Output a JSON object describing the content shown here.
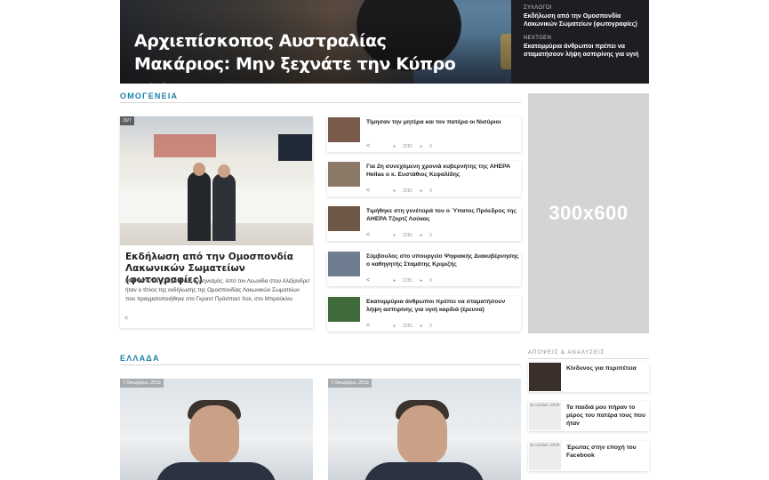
{
  "hero": {
    "title": "Αρχιεπίσκοπος Αυστραλίας Μακάριος: Μην ξεχνάτε την Κύπρο μας",
    "side": [
      {
        "category": "ΣΥΛΛΟΓΟΙ",
        "title": "Εκδήλωση από την Ομοσπονδία Λακωνικών Σωματείων (φωτογραφίες)"
      },
      {
        "category": "NEXTGEN",
        "title": "Εκατομμύρια άνθρωποι πρέπει να σταματήσουν λήψη ασπιρίνης για υγιή"
      }
    ]
  },
  "sections": {
    "omogeneia": "ΟΜΟΓΕΝΕΙΑ",
    "ellada": "ΕΛΛΑΔΑ",
    "opinions": "ΑΠΟΨΕΙΣ & ΑΝΑΛΥΣΕΙΣ"
  },
  "featured": {
    "date": "29/7",
    "title": "Εκδήλωση από την Ομοσπονδία Λακωνικών Σωματείων (φωτογραφίες)",
    "excerpt": "ΜΠΡΟΥΚΛΙΝ. Ολυμπιακός Ελληνισμός. Από τον Λεωνίδα στον Αλέξανδρο' ήταν ο τίτλος της εκδήλωσης της Ομοσπονδίας Λακωνικών Σωματείων που πραγματοποιήθηκε στο Γκραντ Πρόσπεκτ Χολ, στο Μπρούκλιν."
  },
  "list_items": [
    {
      "title": "Τίμησαν την μητέρα και τον πατέρα οι Νισύριοι",
      "views": "2281",
      "comments": "0",
      "thumb_color": "#7a5a4a"
    },
    {
      "title": "Για 2η συνεχόμενη χρονιά κυβερνήτης της AHEPA Hellas ο κ. Ευστάθιος Κεφαλίδης",
      "views": "2281",
      "comments": "0",
      "thumb_color": "#8b7a68"
    },
    {
      "title": "Τιμήθηκε στη γενέτειρά του ο Ύπατος Πρόεδρος της AHEPA Τζορτζ Λούκας",
      "views": "2281",
      "comments": "0",
      "thumb_color": "#6d5747"
    },
    {
      "title": "Σύμβουλος στο υπουργείο Ψηφιακής Διακυβέρνησης ο καθηγητής Σταμάτης Κριμιζής",
      "views": "2281",
      "comments": "0",
      "thumb_color": "#6e7e90"
    },
    {
      "title": "Εκατομμύρια άνθρωποι πρέπει να σταματήσουν λήψη ασπιρίνης για υγιή καρδιά (έρευνα)",
      "views": "2281",
      "comments": "0",
      "thumb_color": "#3f6a3a"
    }
  ],
  "ad": {
    "label": "300x600"
  },
  "opinions": [
    {
      "title": "Κίνδυνος για περιπέτεια",
      "date": ""
    },
    {
      "title": "Τα παιδιά μου πήραν το μέρος του πατέρα τους που ήταν",
      "date": "31 Ιουλίου, 2019"
    },
    {
      "title": "Έρωτας στην εποχή του Facebook",
      "date": "31 Ιουλίου, 2019"
    }
  ],
  "ellada_cards": [
    {
      "date": "7 Οκτωβρίου, 2019"
    },
    {
      "date": "7 Οκτωβρίου, 2019"
    }
  ],
  "icons": {
    "share": "share-icon",
    "eye": "eye-icon",
    "comment": "comment-icon"
  }
}
